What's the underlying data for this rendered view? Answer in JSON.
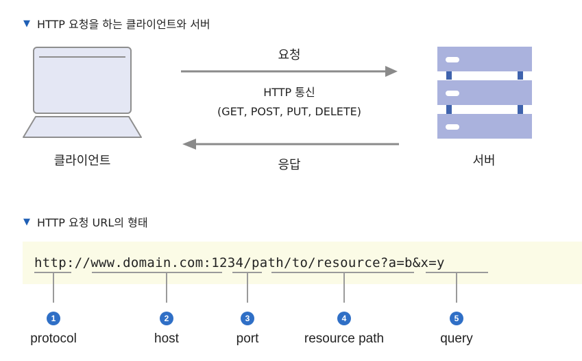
{
  "section1": {
    "title": "HTTP 요청을 하는 클라이언트와 서버"
  },
  "diagram": {
    "request_label": "요청",
    "protocol_line1": "HTTP 통신",
    "protocol_line2": "(GET, POST, PUT, DELETE)",
    "response_label": "응답",
    "client_label": "클라이언트",
    "server_label": "서버",
    "colors": {
      "arrow": "#8a8a8a",
      "laptop_fill": "#e4e7f4",
      "server_fill": "#aab2dd",
      "server_post": "#3f63ad"
    }
  },
  "section2": {
    "title": "HTTP 요청 URL의 형태"
  },
  "url": {
    "scheme": "http",
    "sep1": "://",
    "host": "www.domain.com",
    "sep2": ":",
    "port": "1234",
    "path": "/path/to/resource",
    "sep3": "?",
    "query": "a=b&x=y"
  },
  "parts": [
    {
      "number": "1",
      "label": "protocol"
    },
    {
      "number": "2",
      "label": "host"
    },
    {
      "number": "3",
      "label": "port"
    },
    {
      "number": "4",
      "label": "resource path"
    },
    {
      "number": "5",
      "label": "query"
    }
  ]
}
